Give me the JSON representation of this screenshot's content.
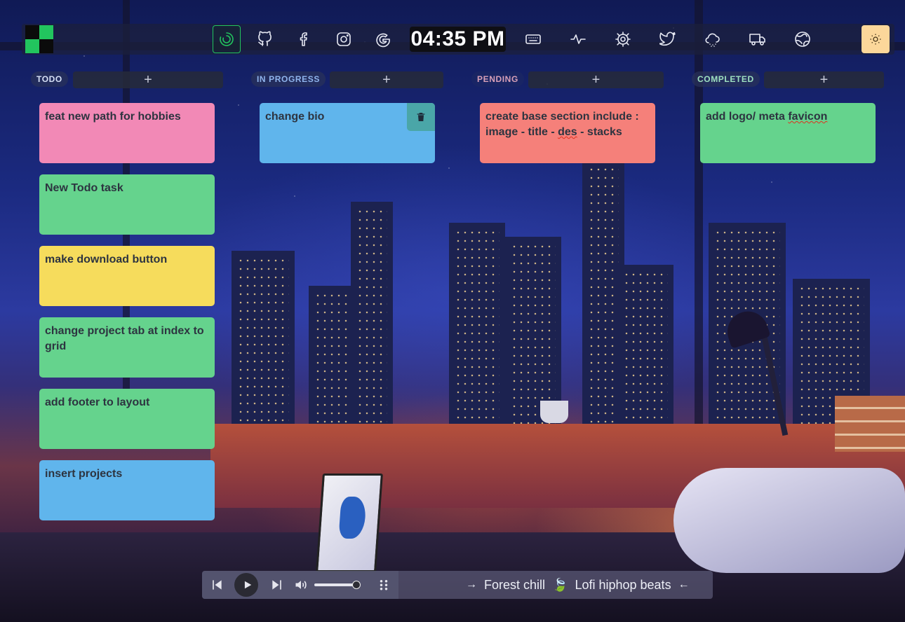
{
  "topbar": {
    "clock": "04:35 PM",
    "icons": [
      {
        "name": "history-icon",
        "active": true
      },
      {
        "name": "github-icon"
      },
      {
        "name": "facebook-icon"
      },
      {
        "name": "instagram-icon"
      },
      {
        "name": "google-icon"
      },
      {
        "name": "keyboard-icon"
      },
      {
        "name": "activity-icon"
      },
      {
        "name": "gear-icon"
      },
      {
        "name": "twitter-icon"
      },
      {
        "name": "weather-icon"
      },
      {
        "name": "truck-icon"
      },
      {
        "name": "globe-icon"
      },
      {
        "name": "sun-icon"
      }
    ],
    "accent_color": "#22c55e",
    "theme_button_color": "#fcd79a"
  },
  "board": {
    "columns": [
      {
        "label": "TODO",
        "add_label": "+",
        "cards": [
          {
            "text": "feat new path for hobbies",
            "color": "#f289b6"
          },
          {
            "text": "New Todo task",
            "color": "#65d38d"
          },
          {
            "text": "make download button",
            "color": "#f6dc5c"
          },
          {
            "text": "change project tab at index to grid",
            "color": "#65d38d"
          },
          {
            "text": "add footer to layout",
            "color": "#65d38d"
          },
          {
            "text": "insert projects",
            "color": "#60b5ec"
          }
        ]
      },
      {
        "label": "IN PROGRESS",
        "add_label": "+",
        "cards": [
          {
            "text": "change bio",
            "color": "#60b5ec"
          }
        ]
      },
      {
        "label": "PENDING",
        "add_label": "+",
        "cards": [
          {
            "text_before": "create base section include : image - title - ",
            "text_spell": "des",
            "text_after": " - stacks",
            "color": "#f5807a"
          }
        ]
      },
      {
        "label": "COMPLETED",
        "add_label": "+",
        "cards": [
          {
            "text_before": "add logo/ meta ",
            "text_spell": "favicon",
            "color": "#65d38d"
          }
        ]
      }
    ]
  },
  "player": {
    "prefix_arrow": "→",
    "title_part1": "Forest chill",
    "emoji": "🍃",
    "title_part2": "Lofi hiphop beats",
    "suffix_arrow": "←",
    "volume": 0.85
  }
}
